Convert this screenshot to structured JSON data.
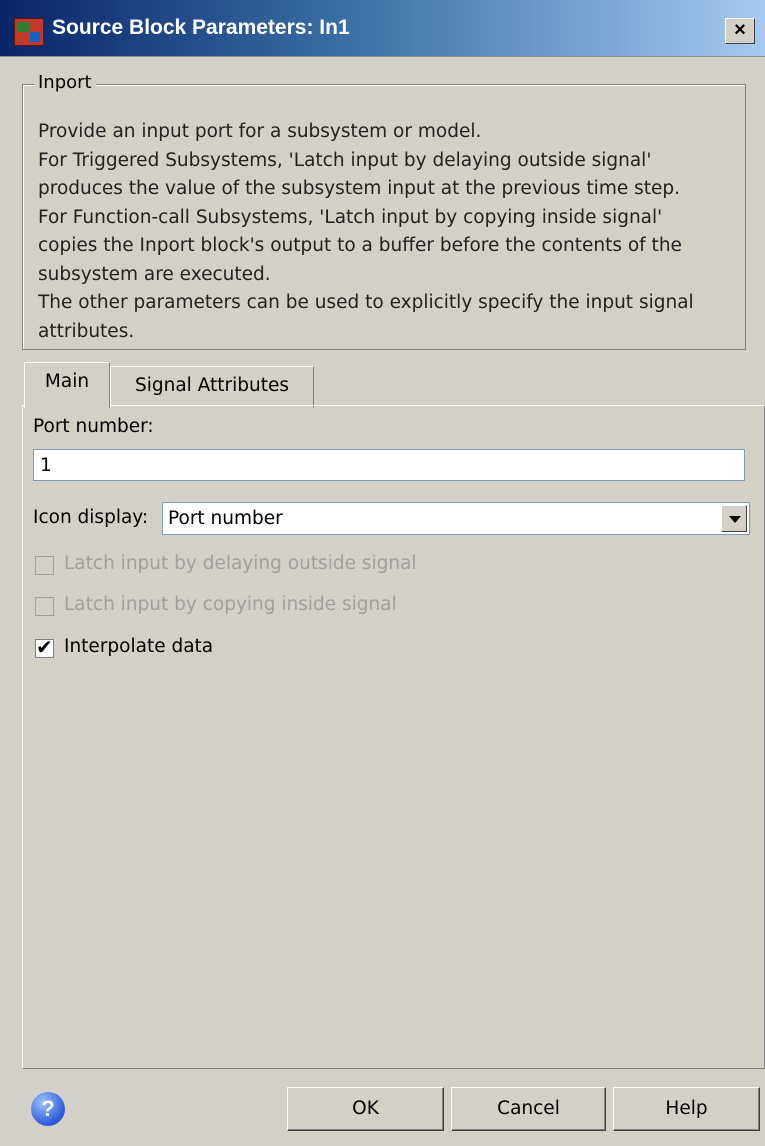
{
  "window": {
    "title": "Source Block Parameters: In1",
    "close_glyph": "×"
  },
  "group": {
    "legend": "Inport",
    "description": "Provide an input port for a subsystem or model.\nFor Triggered Subsystems, 'Latch input by delaying outside signal'\nproduces the value of the subsystem input at the previous time step.\nFor Function-call Subsystems, 'Latch input by copying inside signal'\ncopies the Inport block's output to a buffer before the contents of the\nsubsystem are executed.\nThe other parameters can be used to explicitly specify the input signal\nattributes."
  },
  "tabs": [
    {
      "label": "Main",
      "active": true
    },
    {
      "label": "Signal Attributes",
      "active": false
    }
  ],
  "main": {
    "port_number_label": "Port number:",
    "port_number_value": "1",
    "icon_display_label": "Icon display:",
    "icon_display_value": "Port number",
    "checkboxes": [
      {
        "label": "Latch input by delaying outside signal",
        "checked": false,
        "enabled": false
      },
      {
        "label": "Latch input by copying inside signal",
        "checked": false,
        "enabled": false
      },
      {
        "label": "Interpolate data",
        "checked": true,
        "enabled": true
      }
    ]
  },
  "buttons": {
    "help_icon_glyph": "?",
    "ok": "OK",
    "cancel": "Cancel",
    "help": "Help"
  },
  "icons": {
    "title": "simulink-block-icon",
    "close": "close-icon",
    "help": "help-icon",
    "dropdown": "chevron-down-icon"
  }
}
